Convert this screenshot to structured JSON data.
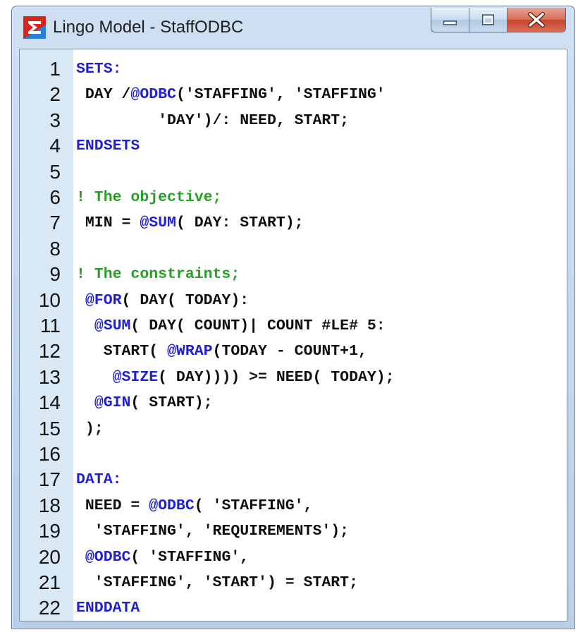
{
  "window": {
    "title": "Lingo Model - StaffODBC",
    "app_icon": "sigma-icon",
    "controls": {
      "minimize_icon": "minimize-icon",
      "maximize_icon": "maximize-icon",
      "close_icon": "close-icon"
    },
    "colors": {
      "keyword": "#1f1fd6",
      "comment": "#25a125",
      "gutter": "#d9e8f5",
      "close": "#c7442a"
    }
  },
  "editor": {
    "lines": [
      {
        "num": "1",
        "segments": [
          {
            "t": "SETS:",
            "c": "kw"
          }
        ]
      },
      {
        "num": "2",
        "segments": [
          {
            "t": " DAY /",
            "c": ""
          },
          {
            "t": "@ODBC",
            "c": "fn"
          },
          {
            "t": "('STAFFING', 'STAFFING'",
            "c": ""
          }
        ]
      },
      {
        "num": "3",
        "segments": [
          {
            "t": "         'DAY')/: NEED, START;",
            "c": ""
          }
        ]
      },
      {
        "num": "4",
        "segments": [
          {
            "t": "ENDSETS",
            "c": "kw"
          }
        ]
      },
      {
        "num": "5",
        "segments": []
      },
      {
        "num": "6",
        "segments": [
          {
            "t": "! The objective;",
            "c": "cm"
          }
        ]
      },
      {
        "num": "7",
        "segments": [
          {
            "t": " MIN = ",
            "c": ""
          },
          {
            "t": "@SUM",
            "c": "fn"
          },
          {
            "t": "( DAY: START);",
            "c": ""
          }
        ]
      },
      {
        "num": "8",
        "segments": []
      },
      {
        "num": "9",
        "segments": [
          {
            "t": "! The constraints;",
            "c": "cm"
          }
        ]
      },
      {
        "num": "10",
        "segments": [
          {
            "t": " ",
            "c": ""
          },
          {
            "t": "@FOR",
            "c": "fn"
          },
          {
            "t": "( DAY( TODAY):",
            "c": ""
          }
        ]
      },
      {
        "num": "11",
        "segments": [
          {
            "t": "  ",
            "c": ""
          },
          {
            "t": "@SUM",
            "c": "fn"
          },
          {
            "t": "( DAY( COUNT)| COUNT #LE# 5:",
            "c": ""
          }
        ]
      },
      {
        "num": "12",
        "segments": [
          {
            "t": "   START( ",
            "c": ""
          },
          {
            "t": "@WRAP",
            "c": "fn"
          },
          {
            "t": "(TODAY - COUNT+1,",
            "c": ""
          }
        ]
      },
      {
        "num": "13",
        "segments": [
          {
            "t": "    ",
            "c": ""
          },
          {
            "t": "@SIZE",
            "c": "fn"
          },
          {
            "t": "( DAY)))) >= NEED( TODAY);",
            "c": ""
          }
        ]
      },
      {
        "num": "14",
        "segments": [
          {
            "t": "  ",
            "c": ""
          },
          {
            "t": "@GIN",
            "c": "fn"
          },
          {
            "t": "( START);",
            "c": ""
          }
        ]
      },
      {
        "num": "15",
        "segments": [
          {
            "t": " );",
            "c": ""
          }
        ]
      },
      {
        "num": "16",
        "segments": []
      },
      {
        "num": "17",
        "segments": [
          {
            "t": "DATA:",
            "c": "kw"
          }
        ]
      },
      {
        "num": "18",
        "segments": [
          {
            "t": " NEED = ",
            "c": ""
          },
          {
            "t": "@ODBC",
            "c": "fn"
          },
          {
            "t": "( 'STAFFING',",
            "c": ""
          }
        ]
      },
      {
        "num": "19",
        "segments": [
          {
            "t": "  'STAFFING', 'REQUIREMENTS');",
            "c": ""
          }
        ]
      },
      {
        "num": "20",
        "segments": [
          {
            "t": " ",
            "c": ""
          },
          {
            "t": "@ODBC",
            "c": "fn"
          },
          {
            "t": "( 'STAFFING',",
            "c": ""
          }
        ]
      },
      {
        "num": "21",
        "segments": [
          {
            "t": "  'STAFFING', 'START') = START;",
            "c": ""
          }
        ]
      },
      {
        "num": "22",
        "segments": [
          {
            "t": "ENDDATA",
            "c": "kw"
          }
        ]
      }
    ]
  }
}
